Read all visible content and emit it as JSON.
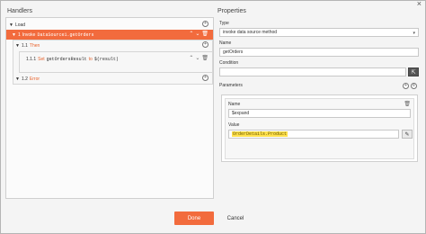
{
  "window": {
    "close_glyph": "×"
  },
  "handlers": {
    "title": "Handlers",
    "items": [
      {
        "label": "Load"
      },
      {
        "prefix": "1",
        "keyword": "Invoke",
        "code": "DataSource1.getOrders"
      },
      {
        "prefix": "1.1",
        "keyword": "Then"
      },
      {
        "prefix": "1.1.1",
        "keyword": "Set",
        "code": "getOrdersResult",
        "op": "to",
        "value": "$(result)"
      },
      {
        "prefix": "1.2",
        "keyword": "Error"
      }
    ]
  },
  "properties": {
    "title": "Properties",
    "type_label": "Type",
    "type_value": "invoke data source method",
    "name_label": "Name",
    "name_value": "getOrders",
    "condition_label": "Condition",
    "condition_value": "",
    "parameters_label": "Parameters",
    "param": {
      "name_label": "Name",
      "name_value": "$expand",
      "value_label": "Value",
      "value_value": "OrderDetails.Product"
    }
  },
  "footer": {
    "done_label": "Done",
    "cancel_label": "Cancel"
  }
}
